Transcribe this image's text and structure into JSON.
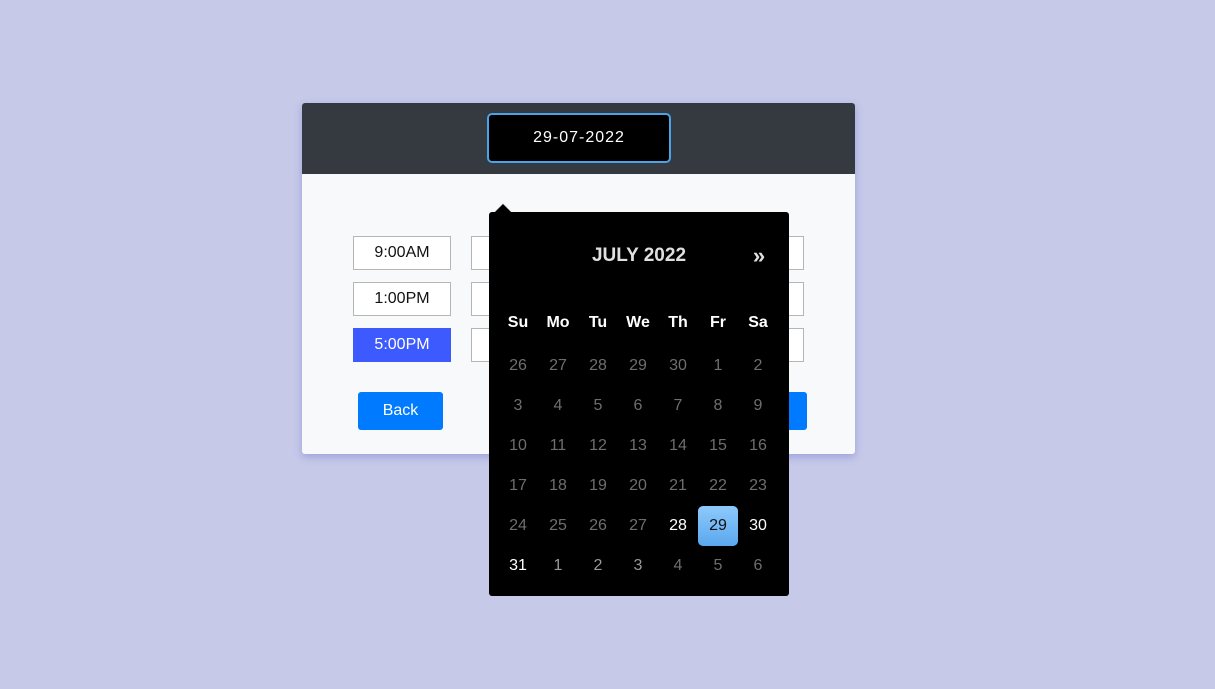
{
  "date_input": {
    "value": "29-07-2022"
  },
  "time_slots": [
    {
      "label": "9:00AM",
      "selected": false
    },
    {
      "label": "1:00PM",
      "selected": false
    },
    {
      "label": "5:00PM",
      "selected": true
    }
  ],
  "buttons": {
    "back_label": "Back"
  },
  "calendar": {
    "month_title": "JULY 2022",
    "next_label": "»",
    "weekdays": [
      "Su",
      "Mo",
      "Tu",
      "We",
      "Th",
      "Fr",
      "Sa"
    ],
    "weeks": [
      [
        {
          "d": "26",
          "state": "disabled"
        },
        {
          "d": "27",
          "state": "disabled"
        },
        {
          "d": "28",
          "state": "disabled"
        },
        {
          "d": "29",
          "state": "disabled"
        },
        {
          "d": "30",
          "state": "disabled"
        },
        {
          "d": "1",
          "state": "disabled"
        },
        {
          "d": "2",
          "state": "disabled"
        }
      ],
      [
        {
          "d": "3",
          "state": "disabled"
        },
        {
          "d": "4",
          "state": "disabled"
        },
        {
          "d": "5",
          "state": "disabled"
        },
        {
          "d": "6",
          "state": "disabled"
        },
        {
          "d": "7",
          "state": "disabled"
        },
        {
          "d": "8",
          "state": "disabled"
        },
        {
          "d": "9",
          "state": "disabled"
        }
      ],
      [
        {
          "d": "10",
          "state": "disabled"
        },
        {
          "d": "11",
          "state": "disabled"
        },
        {
          "d": "12",
          "state": "disabled"
        },
        {
          "d": "13",
          "state": "disabled"
        },
        {
          "d": "14",
          "state": "disabled"
        },
        {
          "d": "15",
          "state": "disabled"
        },
        {
          "d": "16",
          "state": "disabled"
        }
      ],
      [
        {
          "d": "17",
          "state": "disabled"
        },
        {
          "d": "18",
          "state": "disabled"
        },
        {
          "d": "19",
          "state": "disabled"
        },
        {
          "d": "20",
          "state": "disabled"
        },
        {
          "d": "21",
          "state": "disabled"
        },
        {
          "d": "22",
          "state": "disabled"
        },
        {
          "d": "23",
          "state": "disabled"
        }
      ],
      [
        {
          "d": "24",
          "state": "disabled"
        },
        {
          "d": "25",
          "state": "disabled"
        },
        {
          "d": "26",
          "state": "disabled"
        },
        {
          "d": "27",
          "state": "disabled"
        },
        {
          "d": "28",
          "state": "active"
        },
        {
          "d": "29",
          "state": "selected"
        },
        {
          "d": "30",
          "state": "active"
        }
      ],
      [
        {
          "d": "31",
          "state": "active"
        },
        {
          "d": "1",
          "state": "other"
        },
        {
          "d": "2",
          "state": "other"
        },
        {
          "d": "3",
          "state": "other"
        },
        {
          "d": "4",
          "state": "disabled"
        },
        {
          "d": "5",
          "state": "disabled"
        },
        {
          "d": "6",
          "state": "disabled"
        }
      ]
    ]
  },
  "colors": {
    "background": "#c6c9e8",
    "header": "#343a40",
    "accent": "#007bff",
    "selected_slot": "#3d5afe",
    "selected_day": "#6fb7f5"
  }
}
